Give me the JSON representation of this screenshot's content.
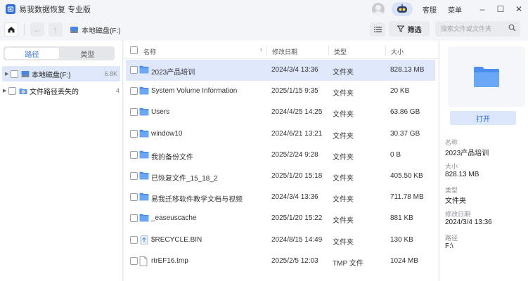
{
  "app": {
    "title": "易我数据恢复 专业版",
    "accent": "#2f6fe4"
  },
  "titlebar": {
    "service": "客服",
    "menu": "菜单",
    "minimize": "–",
    "maximize": "☐",
    "close": "✕"
  },
  "toolbar": {
    "back": "←",
    "up": "↑",
    "breadcrumb": "本地磁盘(F:)",
    "filter_label": "筛选",
    "search_placeholder": "搜索文件或文件夹"
  },
  "sidebar": {
    "tabs": [
      {
        "label": "路径",
        "active": true
      },
      {
        "label": "类型",
        "active": false
      }
    ],
    "tree": [
      {
        "label": "本地磁盘(F:)",
        "count": "6.8K",
        "selected": true,
        "icon": "disk-icon"
      },
      {
        "label": "文件路径丢失的",
        "count": "4",
        "selected": false,
        "icon": "lost-folder-icon"
      }
    ]
  },
  "table": {
    "headers": {
      "name": "名称",
      "date": "修改日期",
      "type": "类型",
      "size": "大小",
      "sort_arrow": "↑"
    },
    "rows": [
      {
        "name": "2023产品培训",
        "date": "2024/3/4 13:36",
        "type": "文件夹",
        "size": "828.13 MB",
        "icon": "folder-icon",
        "selected": true
      },
      {
        "name": "System Volume Information",
        "date": "2025/1/15 9:35",
        "type": "文件夹",
        "size": "20 KB",
        "icon": "folder-icon",
        "selected": false
      },
      {
        "name": "Users",
        "date": "2024/4/25 14:25",
        "type": "文件夹",
        "size": "63.86 GB",
        "icon": "folder-icon",
        "selected": false
      },
      {
        "name": "window10",
        "date": "2024/6/21 13:21",
        "type": "文件夹",
        "size": "30.37 GB",
        "icon": "folder-icon",
        "selected": false
      },
      {
        "name": "我的备份文件",
        "date": "2025/2/24 9:28",
        "type": "文件夹",
        "size": "0 B",
        "icon": "folder-icon",
        "selected": false
      },
      {
        "name": "已恢复文件_15_18_2",
        "date": "2025/1/20 15:18",
        "type": "文件夹",
        "size": "405.50 KB",
        "icon": "folder-icon",
        "selected": false
      },
      {
        "name": "易我迁移软件教学文档与视频",
        "date": "2024/3/4 13:36",
        "type": "文件夹",
        "size": "711.78 MB",
        "icon": "folder-icon",
        "selected": false
      },
      {
        "name": "_easeuscache",
        "date": "2025/1/20 15:22",
        "type": "文件夹",
        "size": "881 KB",
        "icon": "folder-icon",
        "selected": false
      },
      {
        "name": "$RECYCLE.BIN",
        "date": "2024/8/15 14:49",
        "type": "文件夹",
        "size": "130 KB",
        "icon": "recycle-folder-icon",
        "selected": false
      },
      {
        "name": "rtrEF16.tmp",
        "date": "2025/2/5 12:03",
        "type": "TMP 文件",
        "size": "1024 MB",
        "icon": "file-icon",
        "selected": false
      }
    ]
  },
  "details": {
    "open_label": "打开",
    "fields": [
      {
        "label": "名称",
        "value": "2023产品培训"
      },
      {
        "label": "大小",
        "value": "828.13 MB"
      },
      {
        "label": "类型",
        "value": "文件夹"
      },
      {
        "label": "修改日期",
        "value": "2024/3/4 13:36"
      },
      {
        "label": "路径",
        "value": "F:\\"
      }
    ]
  }
}
